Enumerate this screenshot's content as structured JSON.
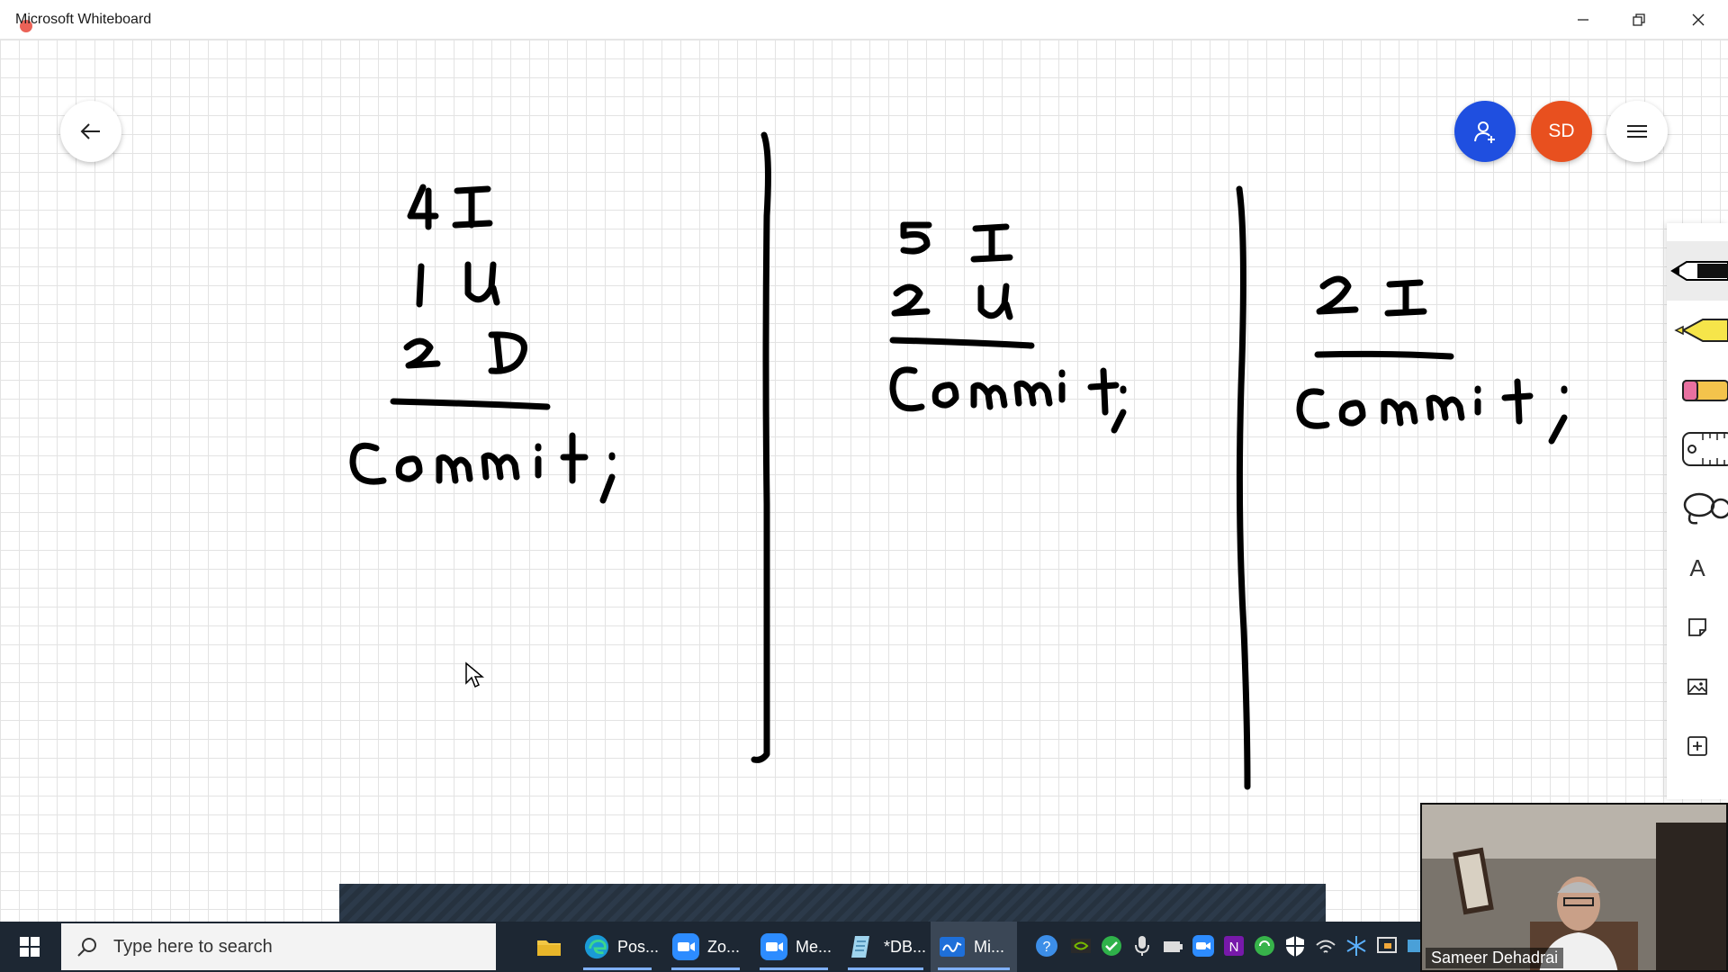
{
  "window": {
    "title": "Microsoft Whiteboard",
    "controls": [
      "minimize",
      "restore",
      "close"
    ]
  },
  "board": {
    "back_icon": "arrow-left-icon",
    "invite_icon": "person-add-icon",
    "avatar_initials": "SD",
    "menu_icon": "hamburger-menu-icon",
    "ink_notes": [
      {
        "column": 1,
        "lines": [
          "4 I",
          "1 U",
          "2 D"
        ],
        "footer": "Commit;"
      },
      {
        "column": 2,
        "lines": [
          "5 I",
          "2 U"
        ],
        "footer": "Commit;"
      },
      {
        "column": 3,
        "lines": [
          "2 I"
        ],
        "footer": "Commit;"
      }
    ]
  },
  "toolbar": {
    "tools": [
      {
        "name": "pen",
        "icon": "pen-icon",
        "selected": true
      },
      {
        "name": "highlighter",
        "icon": "highlighter-icon",
        "selected": false
      },
      {
        "name": "eraser",
        "icon": "eraser-icon",
        "selected": false
      },
      {
        "name": "ruler",
        "icon": "ruler-icon",
        "selected": false
      },
      {
        "name": "lasso",
        "icon": "lasso-icon",
        "selected": false
      },
      {
        "name": "text",
        "icon": "text-icon",
        "label": "A",
        "selected": false
      },
      {
        "name": "note",
        "icon": "note-icon",
        "selected": false
      },
      {
        "name": "image",
        "icon": "image-icon",
        "selected": false
      },
      {
        "name": "add",
        "icon": "plus-icon",
        "selected": false
      }
    ]
  },
  "taskbar": {
    "search_placeholder": "Type here to search",
    "apps": [
      {
        "label": "",
        "icon": "file-explorer-icon"
      },
      {
        "label": "Pos...",
        "icon": "edge-icon"
      },
      {
        "label": "Zo...",
        "icon": "zoom-icon"
      },
      {
        "label": "Me...",
        "icon": "zoom-meeting-icon"
      },
      {
        "label": "*DB...",
        "icon": "notepad-icon"
      },
      {
        "label": "Mi...",
        "icon": "whiteboard-icon"
      }
    ]
  },
  "webcam": {
    "participant_name": "Sameer Dehadrai"
  },
  "colors": {
    "invite": "#1f4fe0",
    "avatar": "#e8501f",
    "taskbar": "#1d2733",
    "ink": "#000000"
  }
}
